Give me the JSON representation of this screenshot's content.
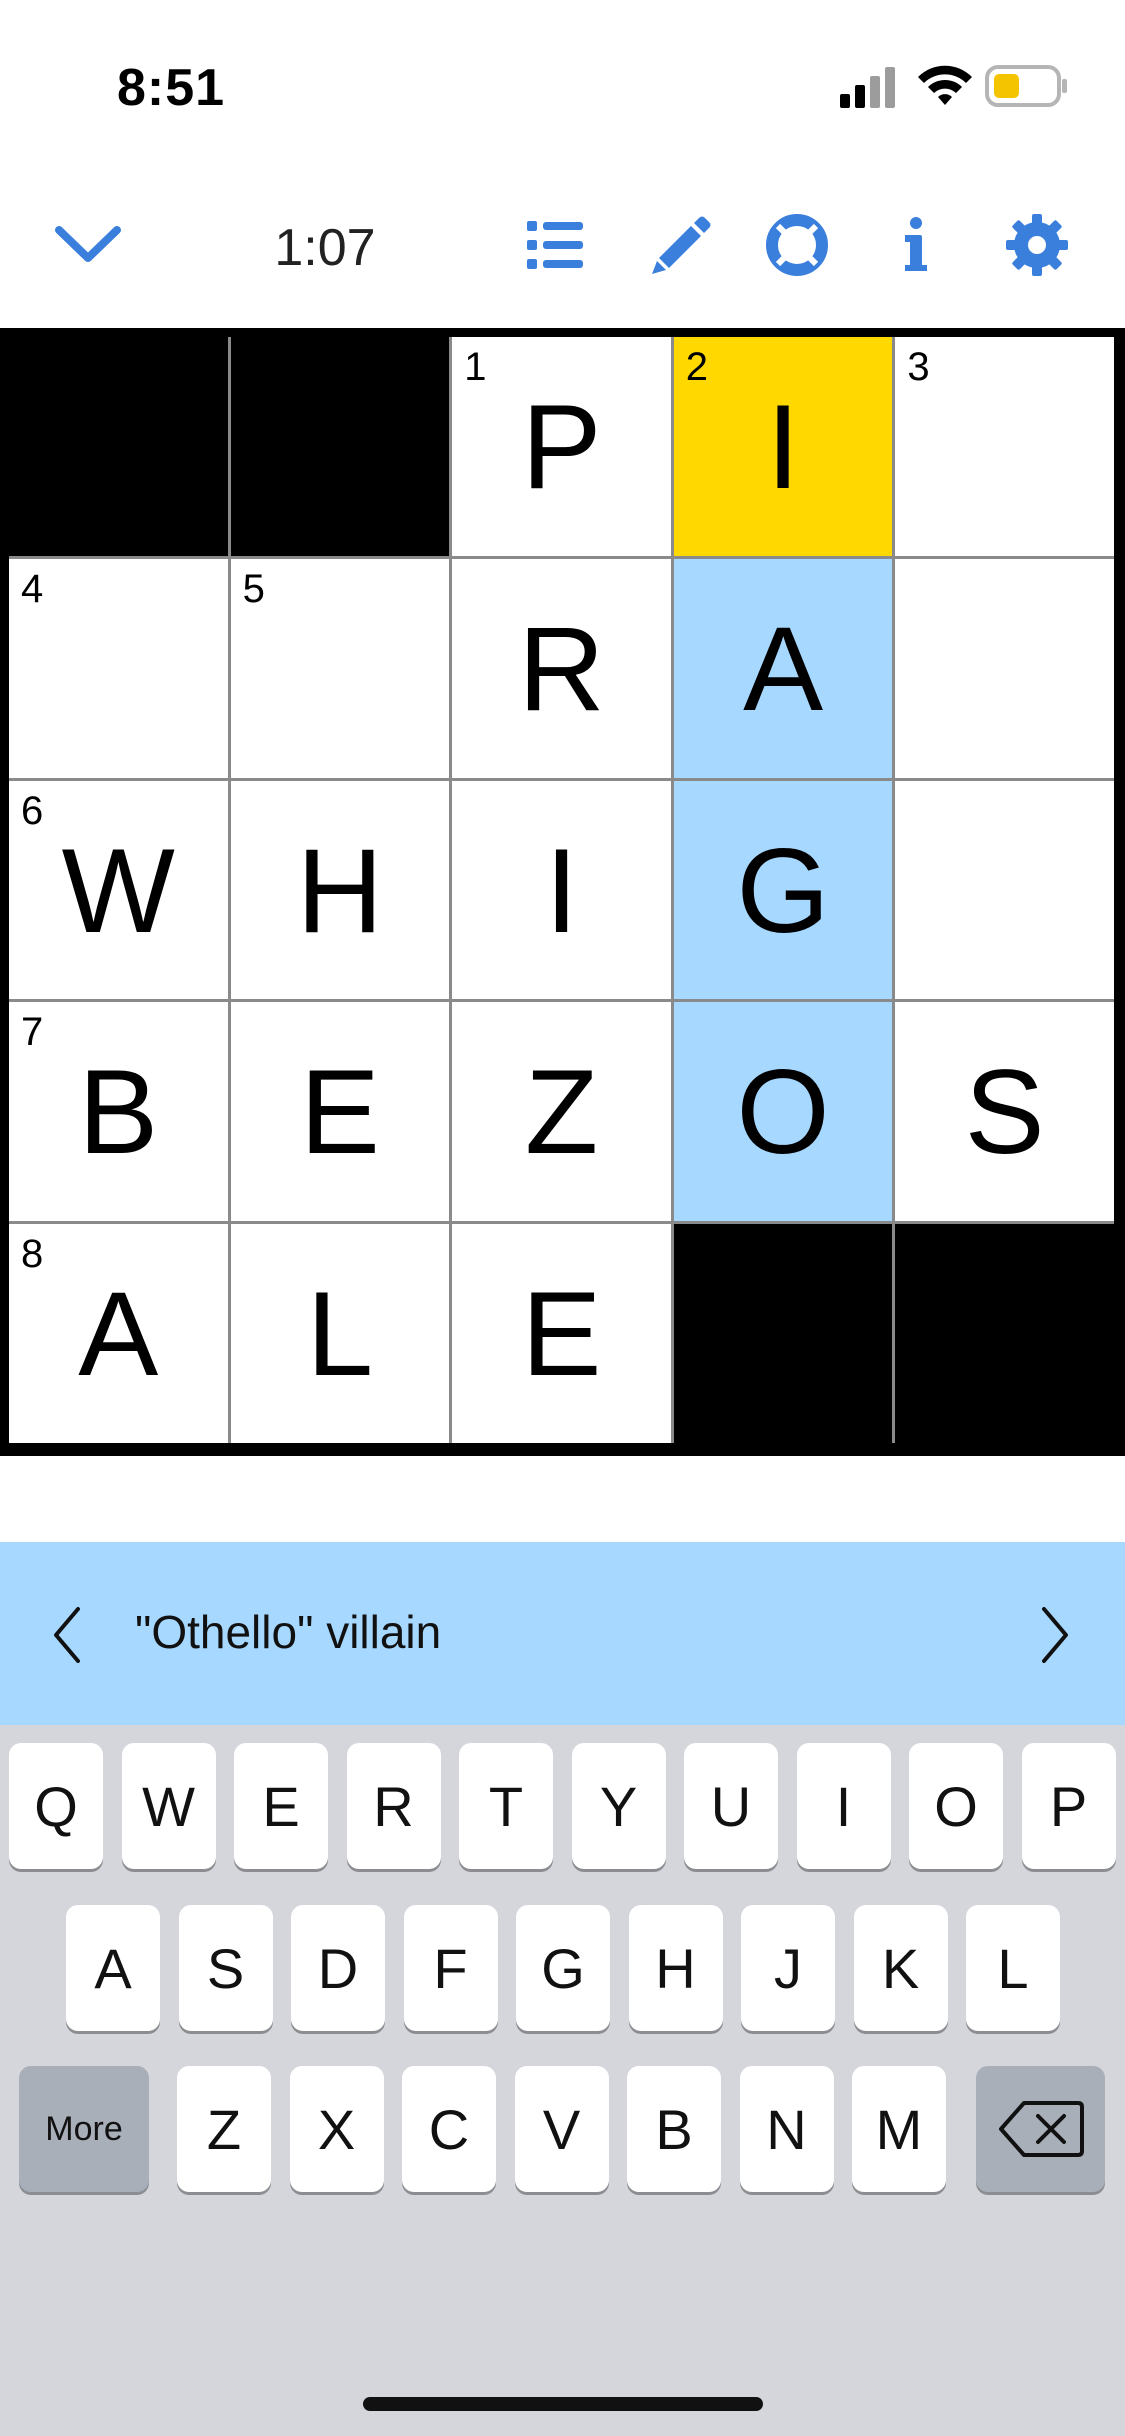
{
  "status": {
    "time": "8:51"
  },
  "toolbar": {
    "timer": "1:07"
  },
  "puzzle": {
    "cells": [
      [
        {
          "block": true
        },
        {
          "block": true
        },
        {
          "num": "1",
          "letter": "P"
        },
        {
          "num": "2",
          "letter": "I",
          "state": "selected"
        },
        {
          "num": "3",
          "letter": ""
        }
      ],
      [
        {
          "num": "4",
          "letter": ""
        },
        {
          "num": "5",
          "letter": ""
        },
        {
          "letter": "R"
        },
        {
          "letter": "A",
          "state": "highlight"
        },
        {
          "letter": ""
        }
      ],
      [
        {
          "num": "6",
          "letter": "W"
        },
        {
          "letter": "H"
        },
        {
          "letter": "I"
        },
        {
          "letter": "G",
          "state": "highlight"
        },
        {
          "letter": ""
        }
      ],
      [
        {
          "num": "7",
          "letter": "B"
        },
        {
          "letter": "E"
        },
        {
          "letter": "Z"
        },
        {
          "letter": "O",
          "state": "highlight"
        },
        {
          "letter": "S"
        }
      ],
      [
        {
          "num": "8",
          "letter": "A"
        },
        {
          "letter": "L"
        },
        {
          "letter": "E"
        },
        {
          "block": true
        },
        {
          "block": true
        }
      ]
    ]
  },
  "clue": {
    "text": "\"Othello\" villain"
  },
  "keyboard": {
    "row1": [
      "Q",
      "W",
      "E",
      "R",
      "T",
      "Y",
      "U",
      "I",
      "O",
      "P"
    ],
    "row2": [
      "A",
      "S",
      "D",
      "F",
      "G",
      "H",
      "J",
      "K",
      "L"
    ],
    "row3": [
      "Z",
      "X",
      "C",
      "V",
      "B",
      "N",
      "M"
    ],
    "more_label": "More"
  },
  "colors": {
    "accent": "#3a7fdc",
    "selected_cell": "#ffd800",
    "highlight_cell": "#a7d8ff",
    "clue_bar": "#a7d8ff",
    "keyboard_bg": "#d4d6db"
  }
}
